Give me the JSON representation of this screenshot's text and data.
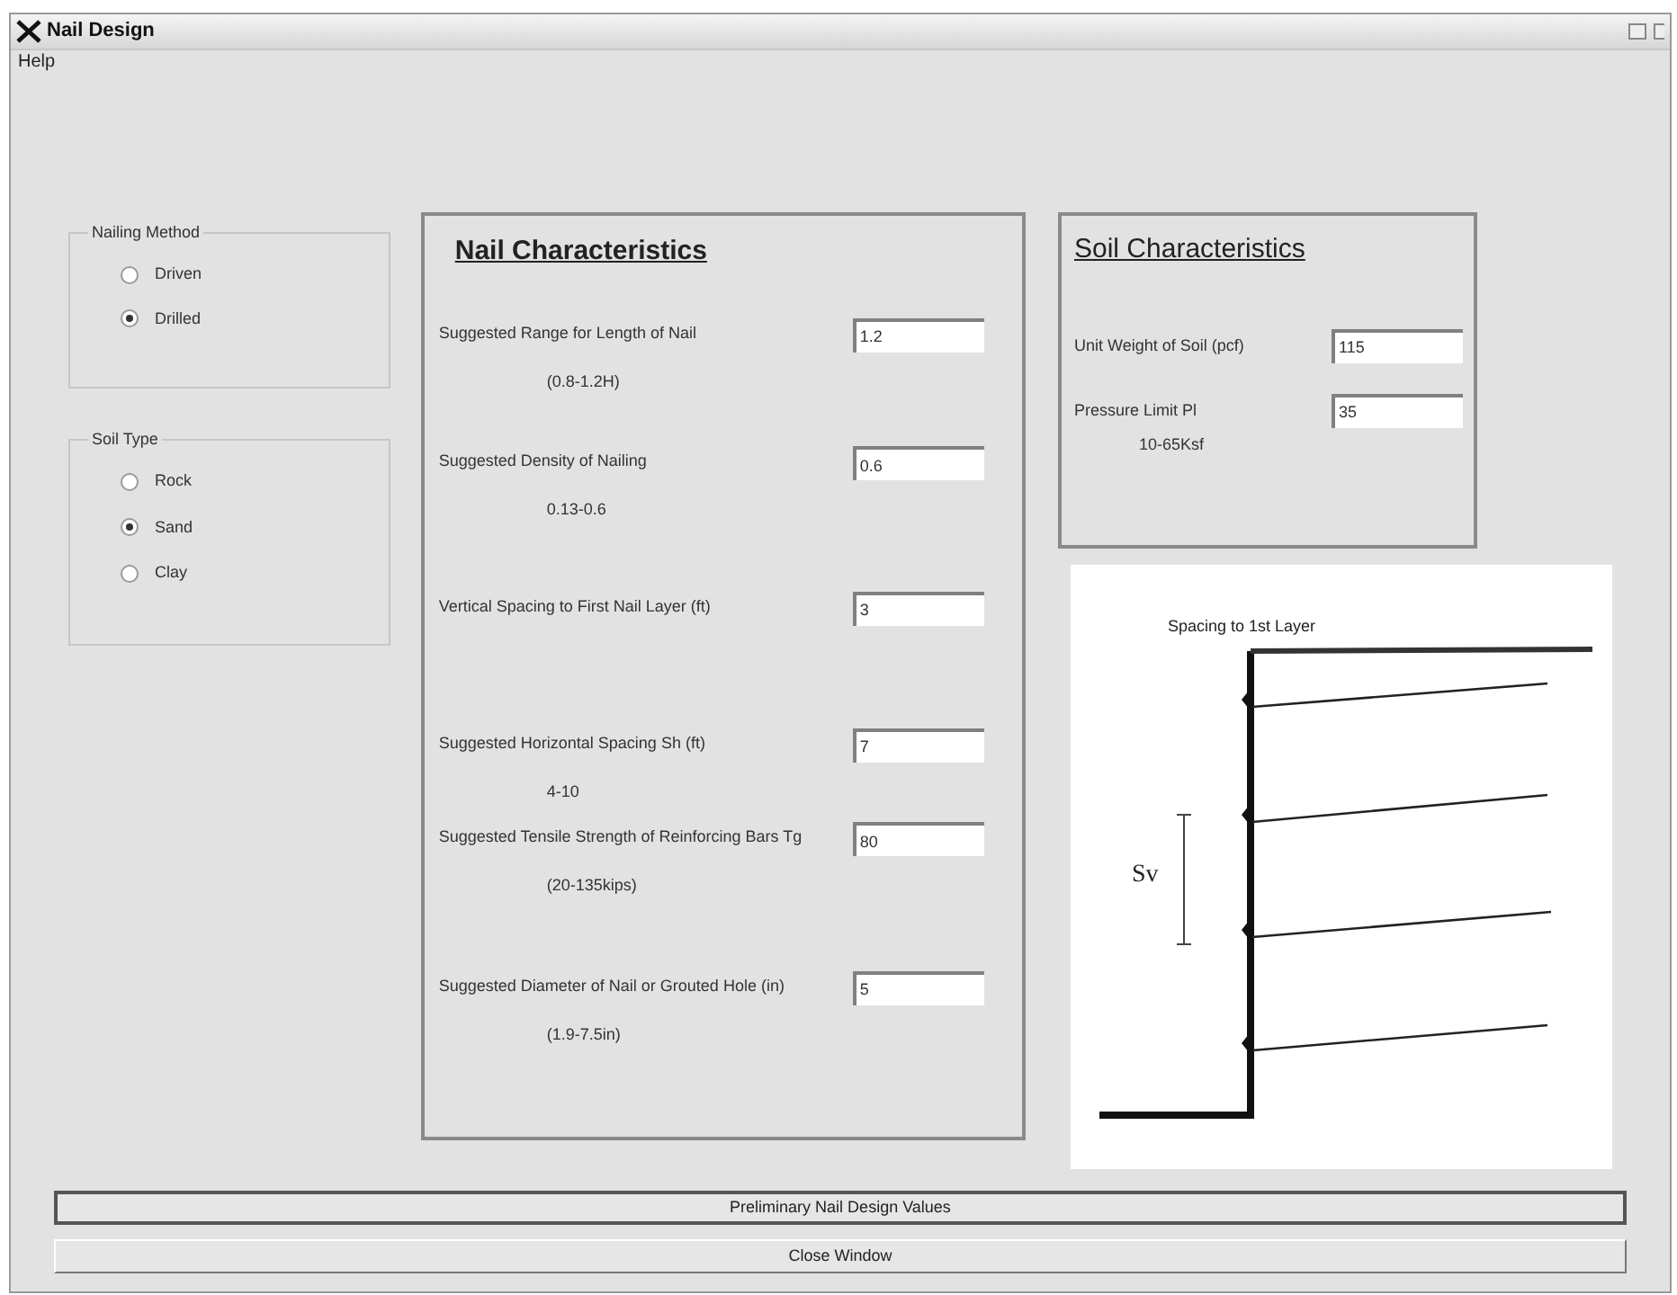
{
  "window": {
    "title": "Nail Design"
  },
  "menu": [
    "Help"
  ],
  "nailing_method": {
    "title": "Nailing Method",
    "options": [
      {
        "label": "Driven",
        "selected": false
      },
      {
        "label": "Drilled",
        "selected": true
      }
    ]
  },
  "soil_type": {
    "title": "Soil Type",
    "options": [
      {
        "label": "Rock",
        "selected": false
      },
      {
        "label": "Sand",
        "selected": true
      },
      {
        "label": "Clay",
        "selected": false
      }
    ]
  },
  "nail_characteristics": {
    "title": "Nail Characteristics",
    "rows": [
      {
        "label": "Suggested Range for Length of Nail",
        "value": "1.2",
        "hint": "(0.8-1.2H)"
      },
      {
        "label": "Suggested Density of Nailing",
        "value": "0.6",
        "hint": "0.13-0.6"
      },
      {
        "label": "Vertical Spacing to First Nail Layer (ft)",
        "value": "3"
      },
      {
        "label": "Suggested Horizontal Spacing Sh (ft)",
        "value": "7",
        "hint": "4-10"
      },
      {
        "label": "Suggested Tensile Strength of Reinforcing Bars Tg",
        "value": "80",
        "hint": "(20-135kips)"
      },
      {
        "label": "Suggested Diameter of Nail or Grouted Hole (in)",
        "value": "5",
        "hint": "(1.9-7.5in)"
      }
    ]
  },
  "soil_characteristics": {
    "title": "Soil Characteristics",
    "rows": [
      {
        "label": "Unit Weight of Soil (pcf)",
        "value": "115"
      },
      {
        "label": "Pressure Limit Pl",
        "value": "35",
        "hint": "10-65Ksf"
      }
    ]
  },
  "diagram": {
    "top_label": "Spacing to 1st Layer",
    "spacing_label": "Sv"
  },
  "buttons": [
    "Preliminary Nail Design Values",
    "Close Window"
  ]
}
